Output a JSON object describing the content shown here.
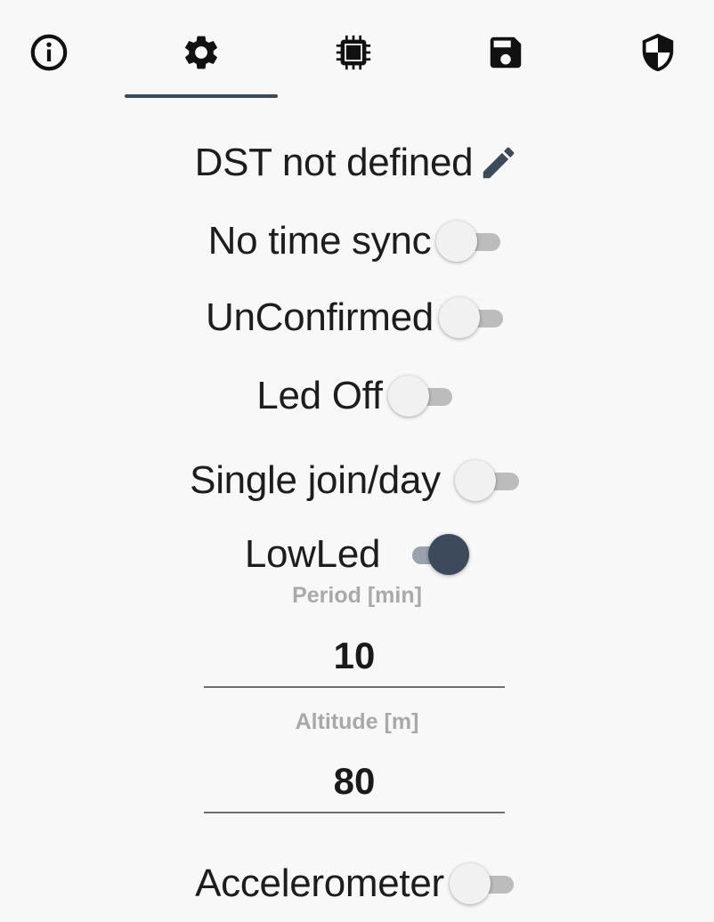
{
  "tabs": [
    {
      "icon": "info-icon"
    },
    {
      "icon": "gear-icon",
      "active": true
    },
    {
      "icon": "chip-icon"
    },
    {
      "icon": "save-icon"
    },
    {
      "icon": "shield-icon"
    }
  ],
  "settings": {
    "dst_label": "DST not defined",
    "time_sync": {
      "label": "No time sync",
      "on": false
    },
    "confirmed": {
      "label": "UnConfirmed",
      "on": false
    },
    "led": {
      "label": "Led Off",
      "on": false
    },
    "single_join": {
      "label": "Single join/day",
      "on": false
    },
    "low_led": {
      "label": "LowLed",
      "on": true
    },
    "period": {
      "label": "Period [min]",
      "value": "10"
    },
    "altitude": {
      "label": "Altitude [m]",
      "value": "80"
    },
    "accelerometer": {
      "label": "Accelerometer",
      "on": false
    }
  },
  "colors": {
    "accent": "#3d4a5c",
    "switch_off_track": "#bcbcbc",
    "switch_off_thumb": "#f1f1f1",
    "field_label": "#a9a9a9"
  }
}
